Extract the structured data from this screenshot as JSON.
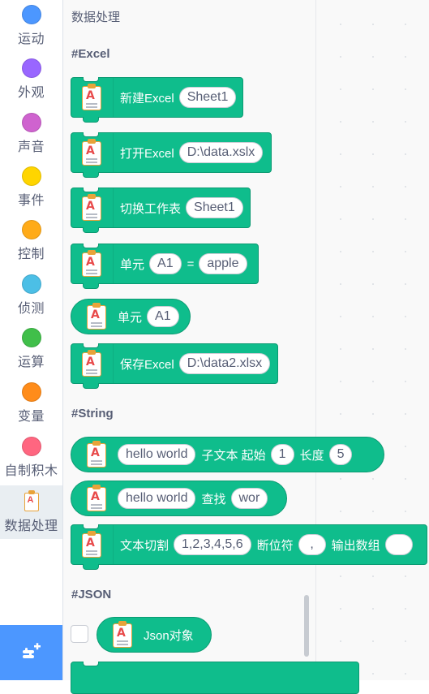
{
  "categories": [
    {
      "label": "运动",
      "color": "#4c97ff"
    },
    {
      "label": "外观",
      "color": "#9966ff"
    },
    {
      "label": "声音",
      "color": "#cf63cf"
    },
    {
      "label": "事件",
      "color": "#ffd500"
    },
    {
      "label": "控制",
      "color": "#ffab19"
    },
    {
      "label": "侦测",
      "color": "#4cbfe6"
    },
    {
      "label": "运算",
      "color": "#40bf4a"
    },
    {
      "label": "变量",
      "color": "#ff8c1a"
    },
    {
      "label": "自制积木",
      "color": "#ff6680"
    },
    {
      "label": "数据处理",
      "color": "#0fbd8c",
      "icon": "clipboard-icon",
      "selected": true
    }
  ],
  "flyout_title": "数据处理",
  "sections": {
    "excel": "#Excel",
    "string": "#String",
    "json": "#JSON"
  },
  "blocks": {
    "new_excel": {
      "label": "新建Excel",
      "arg": "Sheet1"
    },
    "open_excel": {
      "label": "打开Excel",
      "arg": "D:\\data.xslx"
    },
    "switch_sheet": {
      "label": "切换工作表",
      "arg": "Sheet1"
    },
    "cell_set": {
      "label": "单元",
      "cell": "A1",
      "eq": "=",
      "value": "apple"
    },
    "cell_get": {
      "label": "单元",
      "cell": "A1"
    },
    "save_excel": {
      "label": "保存Excel",
      "arg": "D:\\data2.xlsx"
    },
    "substring": {
      "text": "hello world",
      "label1": "子文本 起始",
      "start": "1",
      "label2": "长度",
      "length": "5"
    },
    "find": {
      "text": "hello world",
      "label": "查找",
      "query": "wor"
    },
    "split": {
      "label1": "文本切割",
      "text": "1,2,3,4,5,6",
      "label2": "断位符",
      "sep": ",",
      "label3": "输出数组",
      "out": ""
    },
    "json_obj": {
      "label": "Json对象"
    }
  },
  "extension_button_icon": "add-extension-icon",
  "colors": {
    "block": "#0fbd8c",
    "block_border": "#0b9a72",
    "category_text": "#575e75",
    "extension": "#4c97ff"
  }
}
